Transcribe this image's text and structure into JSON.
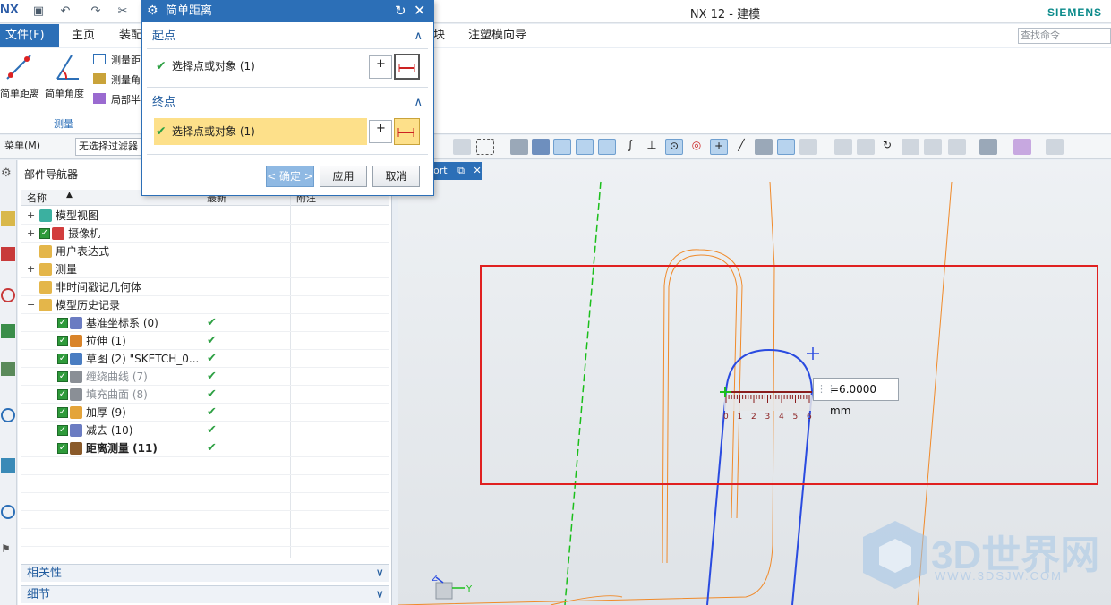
{
  "app": {
    "logo": "NX",
    "title": "NX 12 - 建模",
    "brand": "SIEMENS"
  },
  "menubar": {
    "file": "文件(F)",
    "items": [
      "主页",
      "装配",
      "块",
      "注塑模向导"
    ],
    "search_placeholder": "查找命令"
  },
  "ribbon": {
    "big_buttons": [
      "简单距离",
      "简单角度"
    ],
    "small_buttons": [
      "测量距",
      "测量角",
      "局部半"
    ],
    "group": "测量"
  },
  "toolbar": {
    "menu": "菜单(M)",
    "filter": "无选择过滤器"
  },
  "navigator": {
    "title": "部件导航器",
    "columns": [
      "名称",
      "最新",
      "附注"
    ],
    "rows": [
      {
        "label": "模型视图",
        "expander": "+",
        "checked": false,
        "latest": false,
        "style": ""
      },
      {
        "label": "摄像机",
        "expander": "+",
        "checked": true,
        "latest": false,
        "style": ""
      },
      {
        "label": "用户表达式",
        "expander": "",
        "checked": false,
        "latest": false,
        "style": ""
      },
      {
        "label": "测量",
        "expander": "+",
        "checked": false,
        "latest": false,
        "style": ""
      },
      {
        "label": "非时间戳记几何体",
        "expander": "",
        "checked": false,
        "latest": false,
        "style": ""
      },
      {
        "label": "模型历史记录",
        "expander": "−",
        "checked": false,
        "latest": false,
        "style": ""
      },
      {
        "label": "基准坐标系 (0)",
        "expander": "",
        "checked": true,
        "latest": true,
        "style": ""
      },
      {
        "label": "拉伸 (1)",
        "expander": "",
        "checked": true,
        "latest": true,
        "style": ""
      },
      {
        "label": "草图 (2) \"SKETCH_0...",
        "expander": "",
        "checked": true,
        "latest": true,
        "style": ""
      },
      {
        "label": "缠绕曲线 (7)",
        "expander": "",
        "checked": true,
        "latest": true,
        "style": "grey"
      },
      {
        "label": "填充曲面 (8)",
        "expander": "",
        "checked": true,
        "latest": true,
        "style": "grey"
      },
      {
        "label": "加厚 (9)",
        "expander": "",
        "checked": true,
        "latest": true,
        "style": ""
      },
      {
        "label": "减去 (10)",
        "expander": "",
        "checked": true,
        "latest": true,
        "style": ""
      },
      {
        "label": "距离测量 (11)",
        "expander": "",
        "checked": true,
        "latest": true,
        "style": "bold"
      }
    ],
    "panels": [
      "相关性",
      "细节"
    ]
  },
  "graphics": {
    "tab": "ort",
    "dimension": "=6.0000 mm",
    "ruler_ticks": [
      "0",
      "1",
      "2",
      "3",
      "4",
      "5",
      "6"
    ],
    "axes": {
      "z": "Z",
      "y": "Y"
    },
    "watermark": "3D世界网",
    "watermark_url": "WWW.3DSJW.COM"
  },
  "dialog": {
    "title": "简单距离",
    "start_section": "起点",
    "end_section": "终点",
    "start_select": "选择点或对象 (1)",
    "end_select": "选择点或对象 (1)",
    "ok": "< 确定 >",
    "apply": "应用",
    "cancel": "取消"
  }
}
